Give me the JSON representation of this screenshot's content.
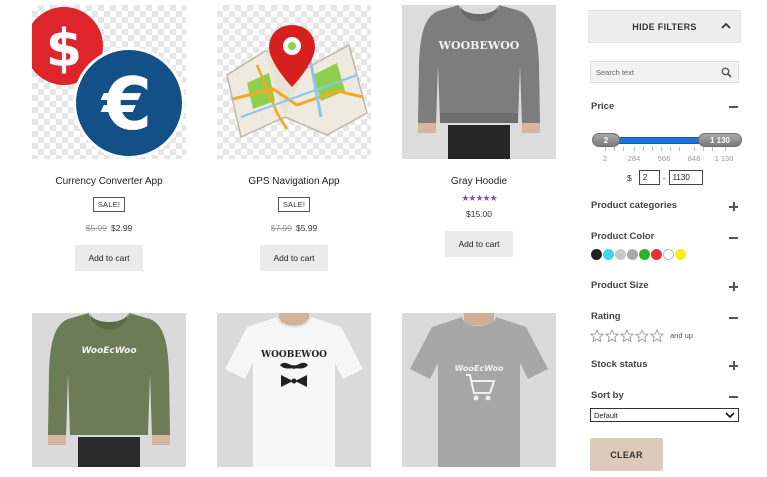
{
  "products": [
    {
      "title": "Currency Converter App",
      "badge": "SALE!",
      "old_price": "$5.99",
      "price": "$2.99",
      "button": "Add to cart"
    },
    {
      "title": "GPS Navigation App",
      "badge": "SALE!",
      "old_price": "$7.99",
      "price": "$5.99",
      "button": "Add to cart"
    },
    {
      "title": "Gray Hoodie",
      "rating": 5,
      "stars": "★★★★★",
      "price": "$15.00",
      "button": "Add to cart"
    },
    {
      "print": "WooEcWoo"
    },
    {
      "print": "WOOBEWOO"
    },
    {
      "print": "WooEcWoo"
    }
  ],
  "gray_hoodie_print": "WOOBEWOO",
  "filters": {
    "hide_label": "HIDE FILTERS",
    "search_placeholder": "Search text",
    "price": {
      "title": "Price",
      "min_value": "2",
      "max_value": "1 130",
      "ticks": [
        "2",
        "284",
        "566",
        "848",
        "1 130"
      ],
      "currency": "$",
      "min_input": "2",
      "separator": "-",
      "max_input": "1130"
    },
    "categories_title": "Product categories",
    "color_title": "Product Color",
    "colors": [
      "#222222",
      "#3ad7ee",
      "#c8c8c8",
      "#a8a8a8",
      "#2bb52b",
      "#e4343a",
      "#ffffff",
      "#f2ee1c"
    ],
    "size_title": "Product Size",
    "rating_title": "Rating",
    "rating_suffix": "and up",
    "stock_title": "Stock status",
    "sort_title": "Sort by",
    "sort_value": "Default",
    "clear_label": "CLEAR"
  }
}
